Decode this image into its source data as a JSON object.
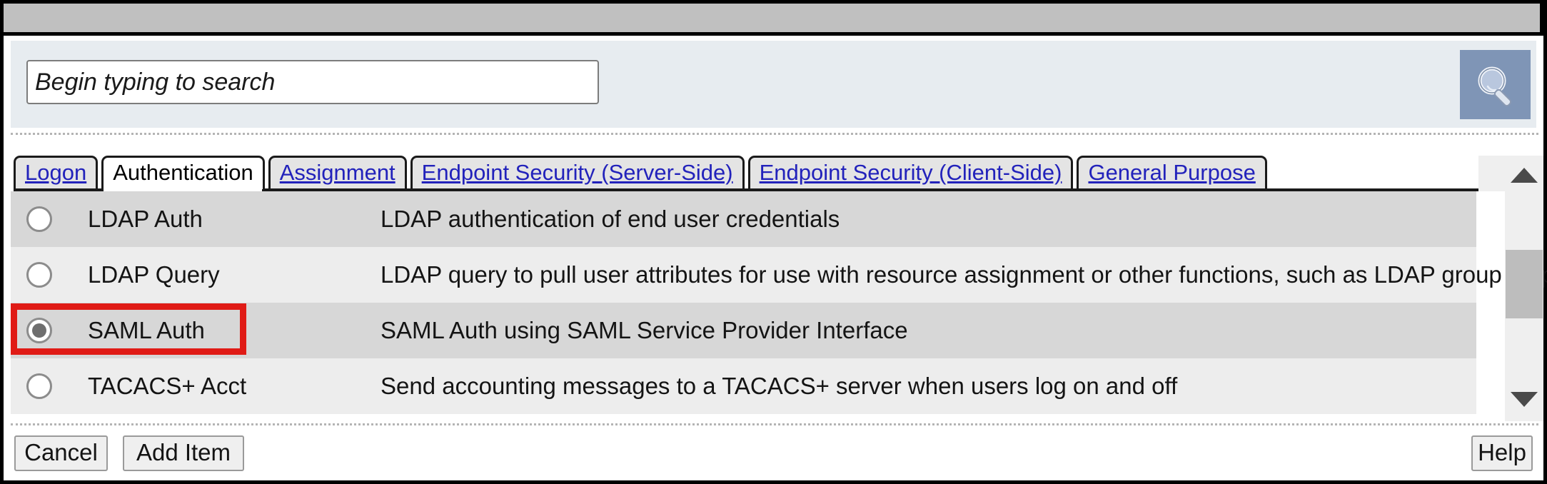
{
  "window": {
    "title": ""
  },
  "search": {
    "placeholder": "Begin typing to search",
    "value": "",
    "button_icon": "search-icon"
  },
  "tabs": [
    {
      "label": "Logon",
      "active": false
    },
    {
      "label": "Authentication",
      "active": true
    },
    {
      "label": "Assignment",
      "active": false
    },
    {
      "label": "Endpoint Security (Server-Side)",
      "active": false
    },
    {
      "label": "Endpoint Security (Client-Side)",
      "active": false
    },
    {
      "label": "General Purpose",
      "active": false
    }
  ],
  "list": {
    "rows": [
      {
        "name": "LDAP Auth",
        "description": "LDAP authentication of end user credentials",
        "selected": false
      },
      {
        "name": "LDAP Query",
        "description": "LDAP query to pull user attributes for use with resource assignment or other functions, such as LDAP group mapping",
        "selected": false
      },
      {
        "name": "SAML Auth",
        "description": "SAML Auth using SAML Service Provider Interface",
        "selected": true
      },
      {
        "name": "TACACS+ Acct",
        "description": "Send accounting messages to a TACACS+ server when users log on and off",
        "selected": false
      }
    ]
  },
  "scrollbar": {
    "up_icon": "chevron-up-icon",
    "down_icon": "chevron-down-icon"
  },
  "footer": {
    "cancel_label": "Cancel",
    "add_item_label": "Add Item",
    "help_label": "Help"
  },
  "annotation": {
    "color": "#e01b16",
    "target": "SAML Auth"
  },
  "colors": {
    "titlebar": "#c0c0c0",
    "search_band": "#e7ecf0",
    "search_button": "#7f95b6",
    "row_odd": "#d7d7d7",
    "row_even": "#ededed",
    "tab_link": "#2222bb",
    "highlight": "#e01b16"
  }
}
